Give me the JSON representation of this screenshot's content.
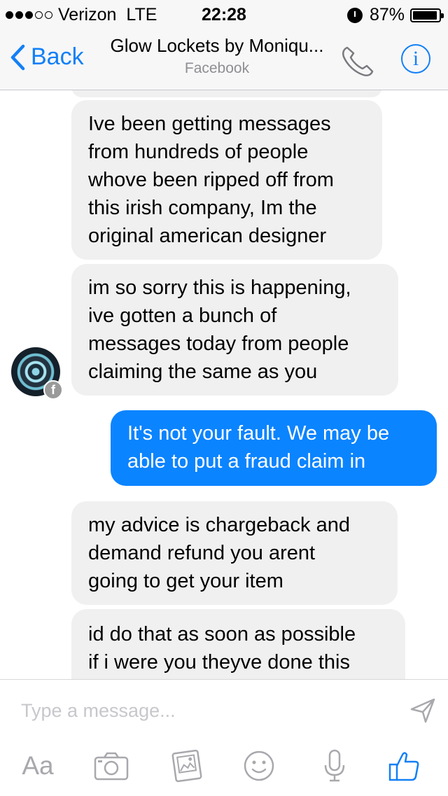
{
  "status_bar": {
    "carrier": "Verizon",
    "network": "LTE",
    "time": "22:28",
    "battery": "87%"
  },
  "nav": {
    "back_label": "Back",
    "title": "Glow Lockets by Moniqu...",
    "subtitle": "Facebook",
    "phone_icon": "phone-icon",
    "info_icon": "info-icon",
    "info_glyph": "i"
  },
  "messages": [
    {
      "sender": "them",
      "lines": [
        "Ive been getting messages",
        "from hundreds of people",
        "whove been ripped off from",
        "this irish company, Im the",
        "original american designer"
      ]
    },
    {
      "sender": "them",
      "lines": [
        "im so sorry this is happening,",
        "ive gotten a bunch of",
        "messages today from people",
        "claiming the same as you"
      ]
    },
    {
      "sender": "me",
      "lines": [
        "It's not your fault. We may be",
        "able to put a fraud claim in"
      ]
    },
    {
      "sender": "them",
      "lines": [
        "my advice is chargeback and",
        "demand refund you arent",
        "going to get your item"
      ]
    },
    {
      "sender": "them",
      "lines": [
        "id do that as soon as possible",
        "if i were you theyve done this"
      ]
    }
  ],
  "contact": {
    "badge": "f"
  },
  "composer": {
    "placeholder": "Type a message...",
    "text_label": "Aa",
    "icons": [
      "send-icon",
      "camera-icon",
      "gallery-icon",
      "emoji-icon",
      "microphone-icon",
      "thumbs-up-icon"
    ]
  },
  "colors": {
    "accent": "#1380f6",
    "outgoing_bubble": "#0b84ff",
    "incoming_bubble": "#f0f0f0"
  }
}
